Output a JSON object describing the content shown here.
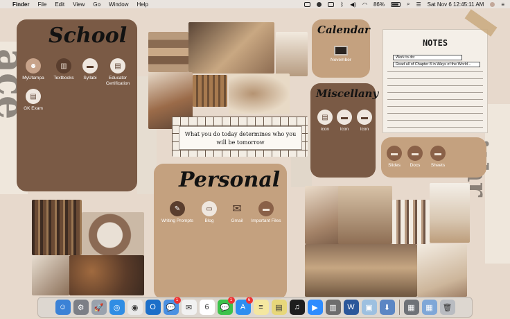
{
  "menubar": {
    "apple": "",
    "items": [
      "Finder",
      "File",
      "Edit",
      "View",
      "Go",
      "Window",
      "Help"
    ],
    "battery": "86%",
    "datetime": "Sat Nov 6  12:45:11 AM"
  },
  "school": {
    "title": "School",
    "apps": [
      {
        "label": "MyUtampa",
        "icon": "user-icon"
      },
      {
        "label": "Textbooks",
        "icon": "books-icon"
      },
      {
        "label": "Syllabi",
        "icon": "folder-icon"
      },
      {
        "label": "Educator Certification",
        "icon": "notebook-icon"
      },
      {
        "label": "GK Exam",
        "icon": "notebook-icon"
      }
    ]
  },
  "calendar": {
    "title": "Calendar",
    "app_label": "November"
  },
  "miscellany": {
    "title": "Miscellany",
    "apps": [
      {
        "label": "icon",
        "icon": "notebook-icon"
      },
      {
        "label": "Icon",
        "icon": "folder-icon"
      },
      {
        "label": "Icon",
        "icon": "folder-icon"
      }
    ]
  },
  "notes": {
    "title": "NOTES",
    "rows": [
      "Work to do:",
      "Read all of Chapter 8 in Ways of the World..."
    ]
  },
  "docs": {
    "apps": [
      {
        "label": "Slides",
        "icon": "folder-icon"
      },
      {
        "label": "Docs",
        "icon": "folder-icon"
      },
      {
        "label": "Sheets",
        "icon": "folder-icon"
      }
    ]
  },
  "quote": "What you do today determines who you will be tomorrow",
  "personal": {
    "title": "Personal",
    "apps": [
      {
        "label": "Writing Prompts",
        "icon": "pencil-icon"
      },
      {
        "label": "Blog",
        "icon": "computer-icon"
      },
      {
        "label": "Gmail",
        "icon": "mail-icon"
      },
      {
        "label": "Important Files",
        "icon": "folder-icon"
      }
    ]
  },
  "dock": {
    "apps": [
      {
        "name": "finder",
        "color": "#3b82d6",
        "glyph": "☺"
      },
      {
        "name": "system-preferences",
        "color": "#7c7f86",
        "glyph": "⚙"
      },
      {
        "name": "launchpad",
        "color": "#9aa2ad",
        "glyph": "🚀"
      },
      {
        "name": "safari",
        "color": "#2f8de4",
        "glyph": "◎"
      },
      {
        "name": "chrome",
        "color": "#e9e9e9",
        "glyph": "◉"
      },
      {
        "name": "outlook",
        "color": "#1c6fc9",
        "glyph": "O"
      },
      {
        "name": "messages-alt",
        "color": "#4a90e2",
        "glyph": "💬",
        "badge": "1"
      },
      {
        "name": "mail",
        "color": "#f1f1f1",
        "glyph": "✉"
      },
      {
        "name": "calendar",
        "color": "#ffffff",
        "glyph": "6"
      },
      {
        "name": "messages",
        "color": "#3cc24a",
        "glyph": "💬",
        "badge": "1"
      },
      {
        "name": "app-store",
        "color": "#2e8ef0",
        "glyph": "A",
        "badge": "6"
      },
      {
        "name": "notes",
        "color": "#f4e7a0",
        "glyph": "≡"
      },
      {
        "name": "stickies",
        "color": "#e7d77a",
        "glyph": "▤"
      },
      {
        "name": "spotify",
        "color": "#1e1e1e",
        "glyph": "♫"
      },
      {
        "name": "zoom",
        "color": "#2d8cff",
        "glyph": "▶"
      },
      {
        "name": "books",
        "color": "#6d6d6d",
        "glyph": "▥"
      },
      {
        "name": "word",
        "color": "#2b579a",
        "glyph": "W"
      },
      {
        "name": "preview",
        "color": "#9dc0e0",
        "glyph": "▣"
      },
      {
        "name": "downloads",
        "color": "#5b86c4",
        "glyph": "⬇"
      },
      {
        "name": "screenshot",
        "color": "#6e7277",
        "glyph": "▦"
      },
      {
        "name": "desktop-folder",
        "color": "#7fa7d7",
        "glyph": "▦"
      },
      {
        "name": "trash",
        "color": "#b9bcc1",
        "glyph": "🗑"
      }
    ]
  }
}
